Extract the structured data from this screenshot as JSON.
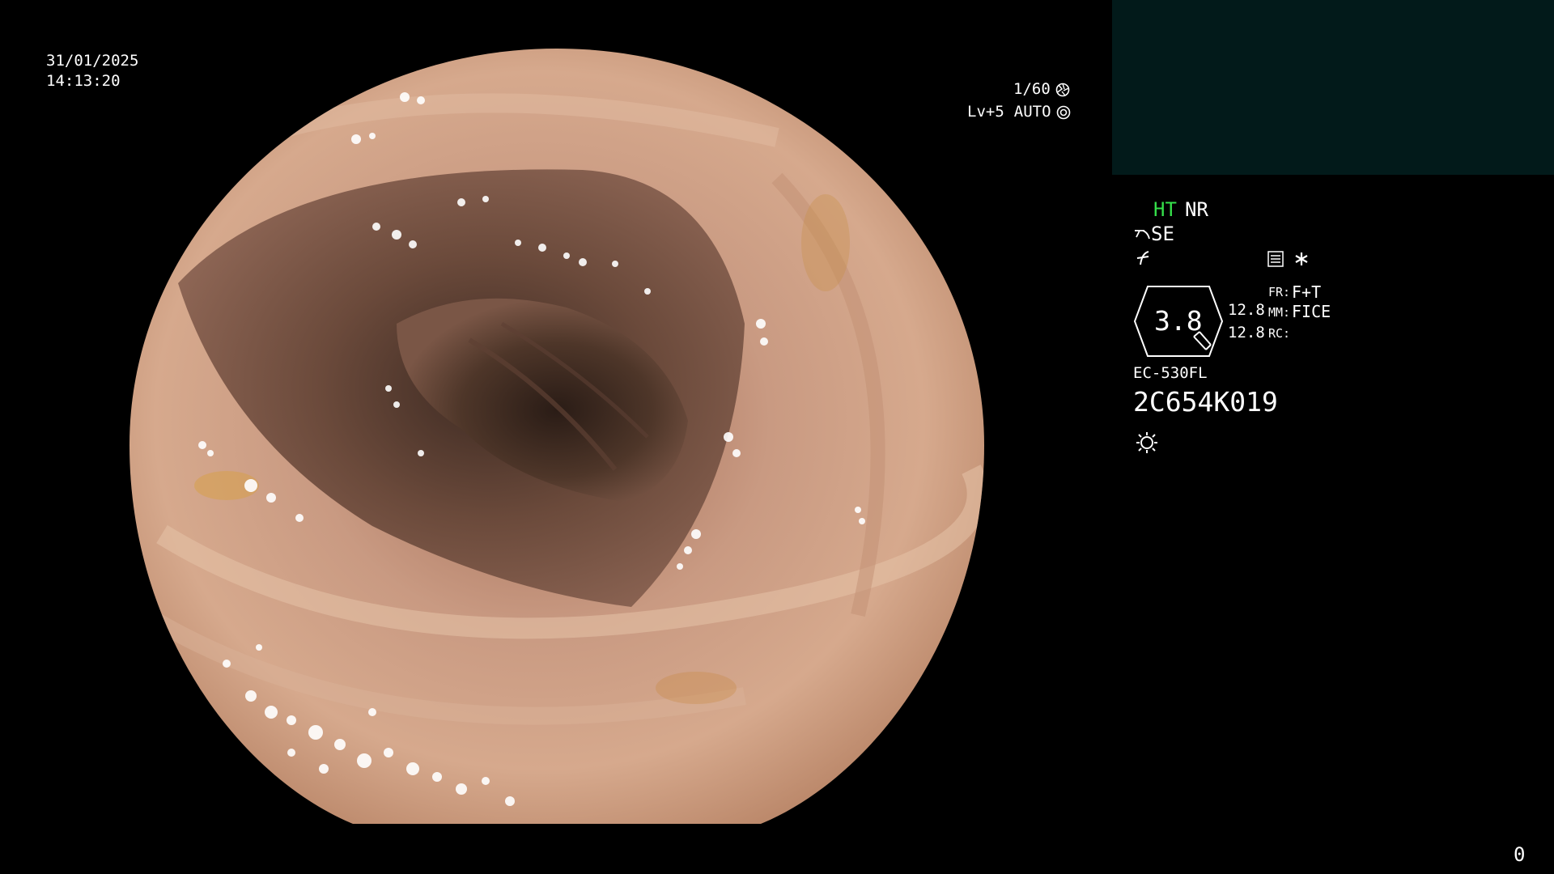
{
  "datetime": {
    "date": "31/01/2025",
    "time": "14:13:20"
  },
  "exposure": {
    "shutter": "1/60",
    "level": "Lv+5",
    "mode": "AUTO"
  },
  "settings": {
    "ht_label": "HT",
    "nr_label": "NR",
    "se_label": "SE",
    "zoom_value": "3.8",
    "left_values": [
      "12.8",
      "12.8"
    ],
    "fr_label": "FR:",
    "fr_value": "F+T",
    "mm_label": "MM:",
    "mm_value": "FICE",
    "rc_label": "RC:",
    "rc_value": ""
  },
  "scope": {
    "model": "EC-530FL",
    "serial": "2C654K019"
  },
  "counter": "0",
  "colors": {
    "ht_green": "#35e04a",
    "thumbnail_bg": "#021a1a",
    "text": "#ffffff"
  },
  "icons": [
    "shutter-icon",
    "auto-iris-icon",
    "scope-se-icon",
    "freeze-icon",
    "menu-icon",
    "asterisk-icon",
    "light-source-icon"
  ]
}
